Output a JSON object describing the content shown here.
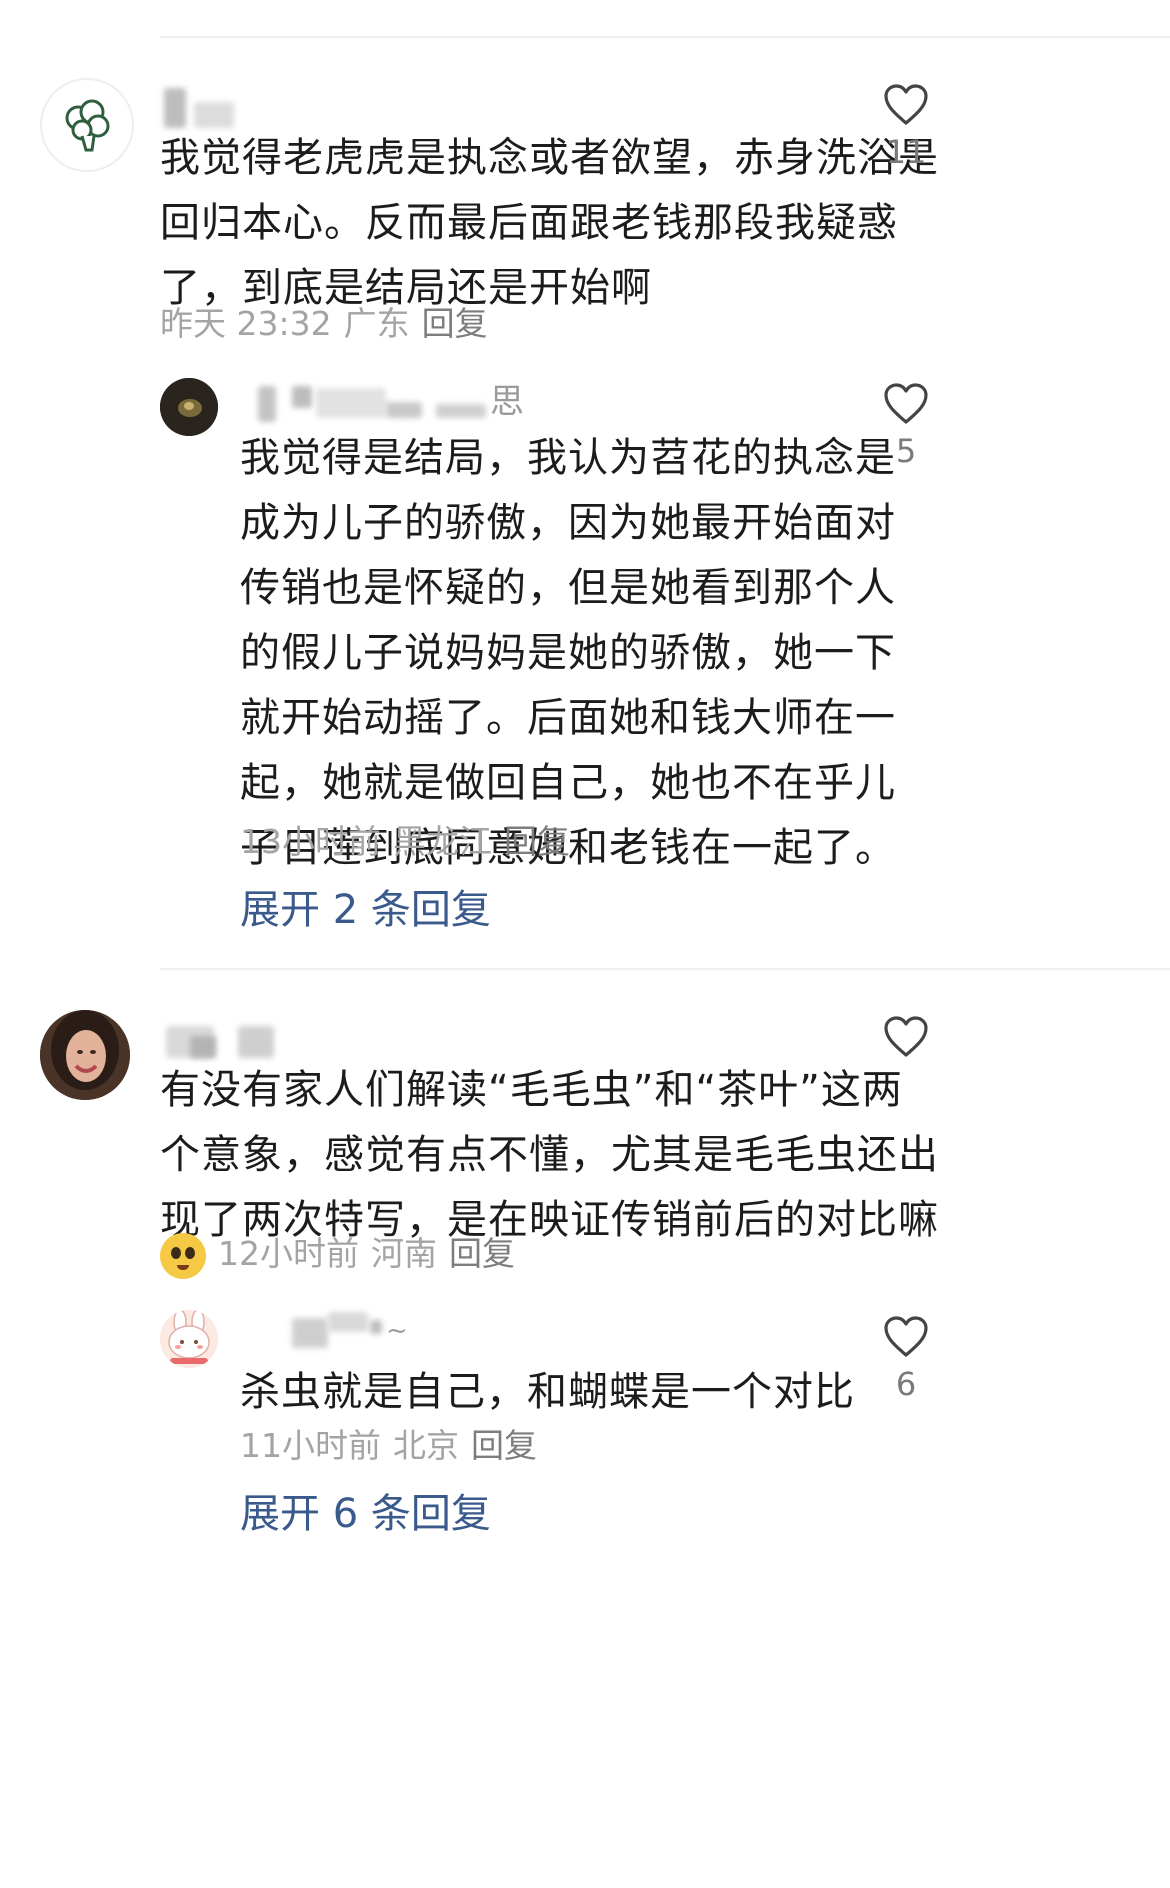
{
  "comments": [
    {
      "text_lines": [
        "我觉得老虎虎是执念或者欲望，赤身洗浴是",
        "回归本心。反而最后面跟老钱那段我疑惑",
        "了，到底是结局还是开始啊"
      ],
      "time": "昨天 23:32",
      "location": "广东",
      "reply_label": "回复",
      "likes": "11",
      "avatar_icon": "broccoli-icon",
      "reply": {
        "username_fragment": "思",
        "text_lines": [
          "我觉得是结局，我认为苕花的执念是",
          "成为儿子的骄傲，因为她最开始面对",
          "传销也是怀疑的，但是她看到那个人",
          "的假儿子说妈妈是她的骄傲，她一下",
          "就开始动摇了。后面她和钱大师在一",
          "起，她就是做回自己，她也不在乎儿",
          "子目莲到底同意她和老钱在一起了。"
        ],
        "time": "13小时前",
        "location": "黑龙江",
        "reply_label": "回复",
        "likes": "5"
      },
      "expand_label": "展开 2 条回复"
    },
    {
      "text_lines": [
        "有没有家人们解读“毛毛虫”和“茶叶”这两",
        "个意象，感觉有点不懂，尤其是毛毛虫还出",
        "现了两次特写，是在映证传销前后的对比嘛"
      ],
      "emoji_icon": "pleading-face-emoji",
      "time": "12小时前",
      "location": "河南",
      "reply_label": "回复",
      "likes": "",
      "reply": {
        "username_fragment": "~",
        "text_lines": [
          "杀虫就是自己，和蝴蝶是一个对比"
        ],
        "time": "11小时前",
        "location": "北京",
        "reply_label": "回复",
        "likes": "6"
      },
      "expand_label": "展开 6 条回复"
    }
  ],
  "colors": {
    "text": "#1c1c1c",
    "meta": "#a4a4a4",
    "link": "#3a5a8c",
    "heart": "#444444"
  }
}
